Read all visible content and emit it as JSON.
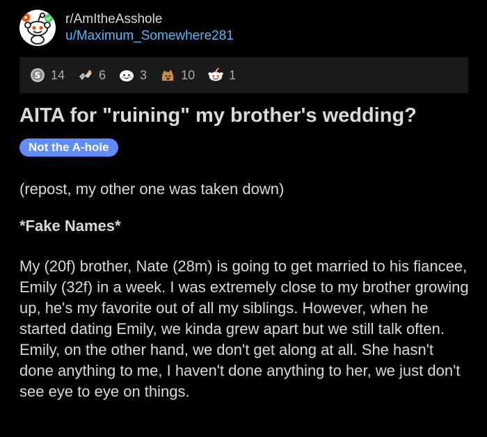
{
  "post": {
    "subreddit": "r/AmItheAsshole",
    "username": "u/Maximum_Somewhere281",
    "awards": [
      {
        "icon": "silver-award-icon",
        "count": "14"
      },
      {
        "icon": "helpful-award-icon",
        "count": "6"
      },
      {
        "icon": "wholesome-award-icon",
        "count": "3"
      },
      {
        "icon": "doge-award-icon",
        "count": "10"
      },
      {
        "icon": "snoo-award-icon",
        "count": "1"
      }
    ],
    "title": "AITA for \"ruining\" my brother's wedding?",
    "flair": "Not the A-hole",
    "body": [
      "(repost, my other one was taken down)",
      "*Fake Names*",
      "My (20f) brother, Nate (28m) is going to get married to his fiancee, Emily (32f) in a week.  I was extremely close to my brother growing up, he's my favorite out of all my siblings.  However, when he started dating Emily, we kinda grew apart but we still talk often.  Emily, on the other hand, we don't get along at all.  She hasn't done anything to me, I haven't done anything to her, we just don't see eye to eye on things."
    ]
  },
  "colors": {
    "background": "#000000",
    "awards_bar": "#1a1a1b",
    "text": "#d7dadc",
    "username": "#4fbcff",
    "flair": "#5e8dff"
  }
}
